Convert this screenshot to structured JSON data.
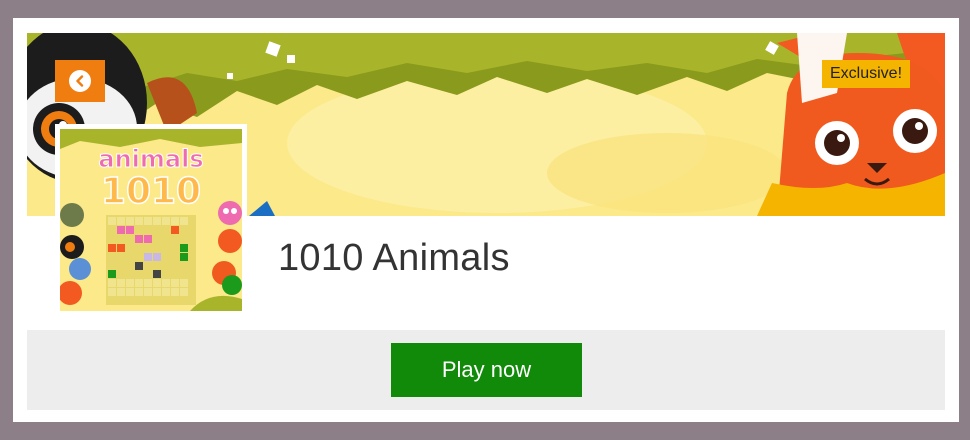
{
  "game": {
    "title": "1010 Animals",
    "badge": "Exclusive!",
    "thumbnail_logo_word": "animals",
    "thumbnail_logo_number": "1010"
  },
  "actions": {
    "back_icon": "chevron-left-icon",
    "play_label": "Play now"
  },
  "colors": {
    "page_background": "#8c7f88",
    "card_background": "#ffffff",
    "back_button": "#f07d10",
    "badge": "#f4b400",
    "play_button": "#108a08",
    "play_bar": "#ededed"
  }
}
